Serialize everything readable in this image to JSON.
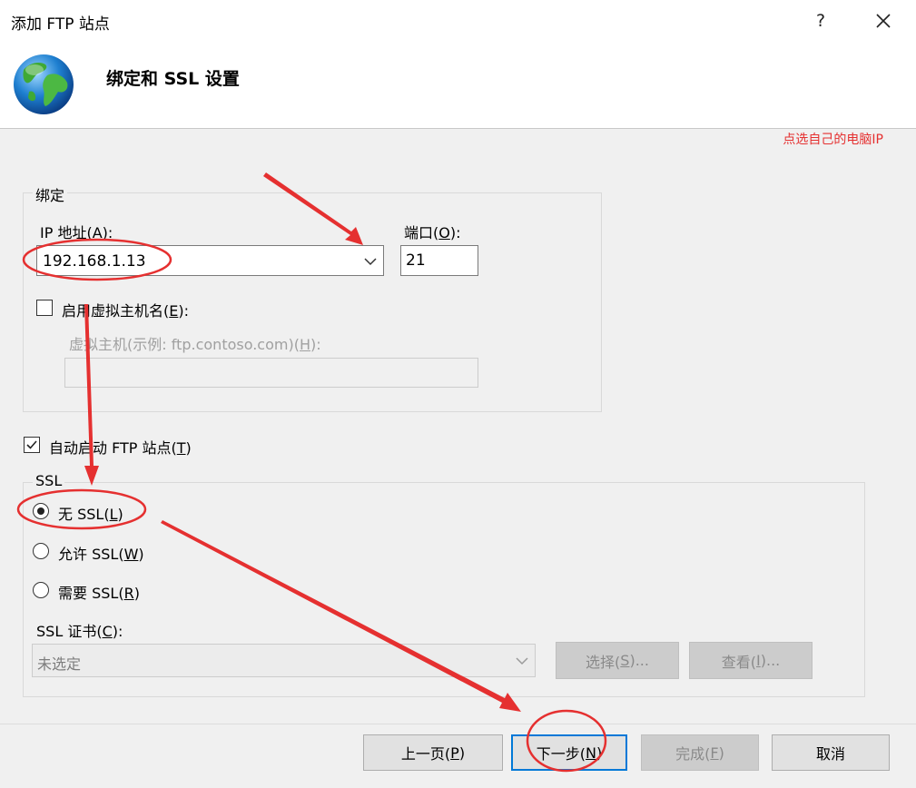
{
  "window": {
    "title": "添加 FTP 站点",
    "help_label": "?"
  },
  "header": {
    "title": "绑定和 SSL 设置"
  },
  "binding": {
    "legend": "绑定",
    "ip_label": "IP 地址(",
    "ip_mnemonic": "A",
    "ip_label_end": "):",
    "ip_value": "192.168.1.13",
    "port_label": "端口(",
    "port_mnemonic": "O",
    "port_label_end": "):",
    "port_value": "21",
    "virtual_host_checkbox_label": "启用虚拟主机名(",
    "virtual_host_checkbox_mnemonic": "E",
    "virtual_host_checkbox_label_end": "):",
    "virtual_host_checked": false,
    "virtual_host_label": "虚拟主机(示例: ftp.contoso.com)(",
    "virtual_host_mnemonic": "H",
    "virtual_host_label_end": "):",
    "virtual_host_value": ""
  },
  "auto_start": {
    "label": "自动启动 FTP 站点(",
    "mnemonic": "T",
    "label_end": ")",
    "checked": true
  },
  "ssl": {
    "legend": "SSL",
    "options": [
      {
        "label": "无 SSL(",
        "mnemonic": "L",
        "label_end": ")",
        "selected": true
      },
      {
        "label": "允许 SSL(",
        "mnemonic": "W",
        "label_end": ")",
        "selected": false
      },
      {
        "label": "需要 SSL(",
        "mnemonic": "R",
        "label_end": ")",
        "selected": false
      }
    ],
    "cert_label": "SSL 证书(",
    "cert_mnemonic": "C",
    "cert_label_end": "):",
    "cert_value": "未选定",
    "select_button": {
      "label": "选择(",
      "mnemonic": "S",
      "label_end": ")..."
    },
    "view_button": {
      "label": "查看(",
      "mnemonic": "I",
      "label_end": ")..."
    }
  },
  "footer": {
    "prev": {
      "label": "上一页(",
      "mnemonic": "P",
      "label_end": ")"
    },
    "next": {
      "label": "下一步(",
      "mnemonic": "N",
      "label_end": ")"
    },
    "finish": {
      "label": "完成(",
      "mnemonic": "F",
      "label_end": ")"
    },
    "cancel": {
      "label": "取消"
    }
  },
  "annotation": {
    "text": "点选自己的电脑IP",
    "color": "#e53030"
  }
}
